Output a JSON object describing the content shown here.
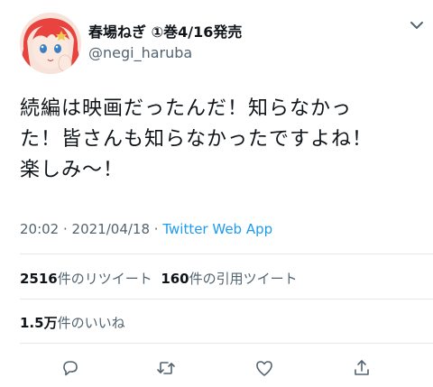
{
  "author": {
    "display_name": "春場ねぎ ①巻4/16発売",
    "handle": "@negi_haruba"
  },
  "tweet": {
    "lines": [
      "続編は映画だったんだ！知らなかっ",
      "た！皆さんも知らなかったですよね！",
      "楽しみ〜！"
    ],
    "time": "20:02",
    "separator1": " · ",
    "date": "2021/04/18",
    "separator2": " · ",
    "app": "Twitter Web App"
  },
  "stats": {
    "retweets_count": "2516",
    "retweets_label": "件のリツイート",
    "quotes_count": "160",
    "quotes_label": "件の引用ツイート",
    "likes_count": "1.5万",
    "likes_label": "件のいいね"
  },
  "icons": {
    "more": "chevron-down-icon",
    "reply": "reply-icon",
    "retweet": "retweet-icon",
    "like": "heart-icon",
    "share": "share-icon"
  },
  "colors": {
    "text": "#0f1419",
    "secondary": "#536471",
    "link": "#1d9bf0",
    "divider": "#e6e9ea"
  }
}
